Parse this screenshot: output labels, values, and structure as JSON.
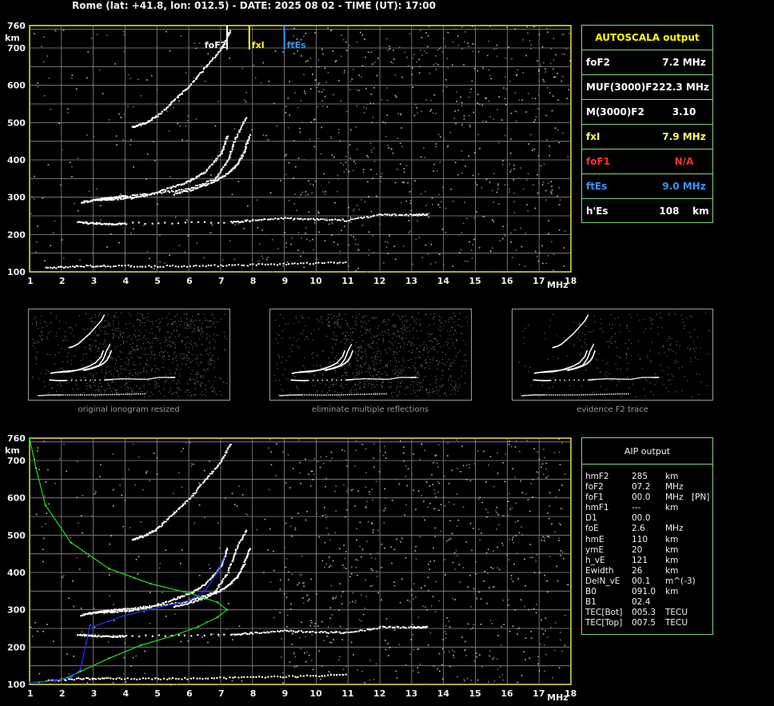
{
  "header": "Rome (lat: +41.8, lon: 012.5) - DATE: 2025 08 02 - TIME (UT): 17:00",
  "chart_data": [
    {
      "type": "scatter",
      "name": "ionogram",
      "xlabel": "MHz",
      "ylabel": "km",
      "xlim": [
        1,
        18
      ],
      "ylim": [
        100,
        760
      ],
      "xticks": [
        "1",
        "2",
        "3",
        "4",
        "5",
        "6",
        "7",
        "8",
        "9",
        "10",
        "11",
        "12",
        "13",
        "14",
        "15",
        "16",
        "17",
        "18"
      ],
      "yticks": [
        "100",
        "200",
        "300",
        "400",
        "500",
        "600",
        "700",
        "760"
      ],
      "grid": true,
      "markers": [
        {
          "label": "foF2",
          "x": 7.2,
          "color": "#ffffff"
        },
        {
          "label": "fxI",
          "x": 7.9,
          "color": "#ffff00"
        },
        {
          "label": "ftEs",
          "x": 9.0,
          "color": "#3399ff"
        }
      ],
      "traces": [
        {
          "name": "Es",
          "x": [
            1.5,
            2.5,
            3.5,
            5.0,
            6.5,
            8.0,
            9.5,
            11.0
          ],
          "y": [
            112,
            117,
            118,
            117,
            118,
            121,
            124,
            127
          ]
        },
        {
          "name": "F1",
          "x": [
            2.6,
            3.0,
            3.5,
            4.0,
            5.0,
            6.0,
            6.8,
            7.2,
            7.45,
            7.8
          ],
          "y": [
            288,
            294,
            300,
            305,
            313,
            325,
            350,
            400,
            460,
            520
          ]
        },
        {
          "name": "F2o",
          "x": [
            3.1,
            3.6,
            4.2,
            4.8,
            5.5,
            6.0,
            6.5,
            7.0,
            7.2
          ],
          "y": [
            295,
            297,
            300,
            310,
            330,
            345,
            370,
            420,
            470
          ]
        },
        {
          "name": "F2x",
          "x": [
            5.5,
            6.2,
            6.8,
            7.2,
            7.5,
            7.7,
            7.9
          ],
          "y": [
            310,
            325,
            345,
            365,
            390,
            420,
            470
          ]
        },
        {
          "name": "multiple",
          "x": [
            4.2,
            4.6,
            5.0,
            5.5,
            6.0,
            6.5,
            7.0,
            7.3
          ],
          "y": [
            490,
            500,
            520,
            560,
            600,
            650,
            700,
            750
          ]
        },
        {
          "name": "Es2",
          "x": [
            2.5,
            3.0,
            3.5,
            4.0,
            7.3,
            8.0,
            9.0,
            10.0,
            11.0,
            12.0,
            13.0,
            13.5
          ],
          "y": [
            235,
            232,
            230,
            232,
            235,
            240,
            245,
            242,
            240,
            255,
            255,
            255
          ]
        }
      ]
    },
    {
      "type": "scatter",
      "name": "aip-profile",
      "xlabel": "MHz",
      "ylabel": "km",
      "xlim": [
        1,
        18
      ],
      "ylim": [
        100,
        760
      ],
      "xticks": [
        "1",
        "2",
        "3",
        "4",
        "5",
        "6",
        "7",
        "8",
        "9",
        "10",
        "11",
        "12",
        "13",
        "14",
        "15",
        "16",
        "17",
        "18"
      ],
      "yticks": [
        "100",
        "200",
        "300",
        "400",
        "500",
        "600",
        "700",
        "760"
      ],
      "grid": true,
      "series": [
        {
          "color": "#22dd22",
          "x": [
            1.0,
            1.3,
            1.8,
            2.2,
            2.6,
            3.5,
            4.5,
            5.5,
            6.3,
            6.9,
            7.2,
            6.9,
            6.0,
            4.8,
            3.5,
            2.3,
            1.5,
            1.2,
            1.0
          ],
          "y": [
            105,
            106,
            110,
            118,
            135,
            170,
            205,
            230,
            255,
            280,
            300,
            320,
            345,
            370,
            410,
            480,
            580,
            680,
            760
          ]
        },
        {
          "color": "#2233ff",
          "x": [
            1.0,
            1.8,
            2.3,
            2.6,
            2.9,
            3.0,
            3.5,
            4.0,
            5.0,
            6.0,
            6.5,
            6.9,
            7.1
          ],
          "y": [
            105,
            110,
            118,
            140,
            260,
            255,
            270,
            285,
            305,
            325,
            350,
            400,
            440
          ]
        }
      ]
    }
  ],
  "autoscala": {
    "title": "AUTOSCALA output",
    "rows": [
      {
        "name": "foF2",
        "value": "7.2 MHz",
        "color": "#ffffff"
      },
      {
        "name": "MUF(3000)F2",
        "value": "22.3 MHz",
        "color": "#ffffff"
      },
      {
        "name": "M(3000)F2",
        "value": "3.10",
        "color": "#ffffff"
      },
      {
        "name": "fxI",
        "value": "7.9 MHz",
        "color": "#ffff66"
      },
      {
        "name": "foF1",
        "value": "N/A",
        "color": "#ff3333"
      },
      {
        "name": "ftEs",
        "value": "9.0 MHz",
        "color": "#3399ff"
      },
      {
        "name": "h'Es",
        "value": "108    km",
        "color": "#ffffff"
      }
    ]
  },
  "thumbnails": [
    {
      "caption": "original ionogram resized"
    },
    {
      "caption": "eliminate multiple reflections"
    },
    {
      "caption": "evidence F2 trace"
    }
  ],
  "aip": {
    "title": "AIP output",
    "rows": [
      {
        "name": "hmF2",
        "value": "285",
        "unit": "km",
        "extra": ""
      },
      {
        "name": "foF2",
        "value": "07.2",
        "unit": "MHz",
        "extra": ""
      },
      {
        "name": "foF1",
        "value": "00.0",
        "unit": "MHz",
        "extra": "[PN]"
      },
      {
        "name": "hmF1",
        "value": "---",
        "unit": "km",
        "extra": ""
      },
      {
        "name": "D1",
        "value": "00.0",
        "unit": "",
        "extra": ""
      },
      {
        "name": "foE",
        "value": "2.6",
        "unit": "MHz",
        "extra": ""
      },
      {
        "name": "hmE",
        "value": "110",
        "unit": "km",
        "extra": ""
      },
      {
        "name": "ymE",
        "value": "20",
        "unit": "km",
        "extra": ""
      },
      {
        "name": "h_vE",
        "value": "121",
        "unit": "km",
        "extra": ""
      },
      {
        "name": "Ewidth",
        "value": "26",
        "unit": "km",
        "extra": ""
      },
      {
        "name": "DelN_vE",
        "value": "00.1",
        "unit": "m^(-3)",
        "extra": ""
      },
      {
        "name": "B0",
        "value": "091.0",
        "unit": "km",
        "extra": ""
      },
      {
        "name": "B1",
        "value": "02.4",
        "unit": "",
        "extra": ""
      },
      {
        "name": "TEC[Bot]",
        "value": "005.3",
        "unit": "TECU",
        "extra": ""
      },
      {
        "name": "TEC[Top]",
        "value": "007.5",
        "unit": "TECU",
        "extra": ""
      }
    ]
  }
}
